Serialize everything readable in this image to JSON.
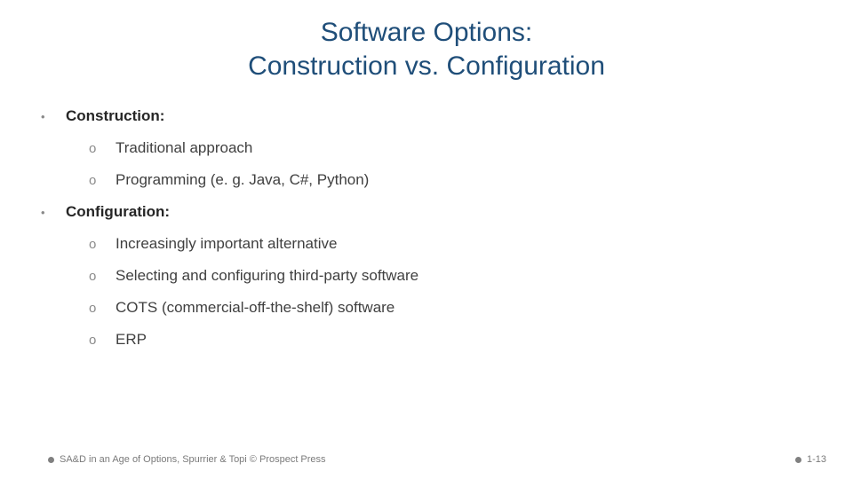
{
  "title_line1": "Software Options:",
  "title_line2": "Construction vs. Configuration",
  "bullets": [
    {
      "label": "Construction:",
      "sub": [
        "Traditional approach",
        "Programming (e. g. Java, C#, Python)"
      ]
    },
    {
      "label": "Configuration:",
      "sub": [
        "Increasingly important alternative",
        "Selecting and configuring third-party software",
        "COTS (commercial-off-the-shelf) software",
        "ERP"
      ]
    }
  ],
  "footer_left": "SA&D in an Age of Options, Spurrier & Topi © Prospect Press",
  "footer_right": "1-13"
}
